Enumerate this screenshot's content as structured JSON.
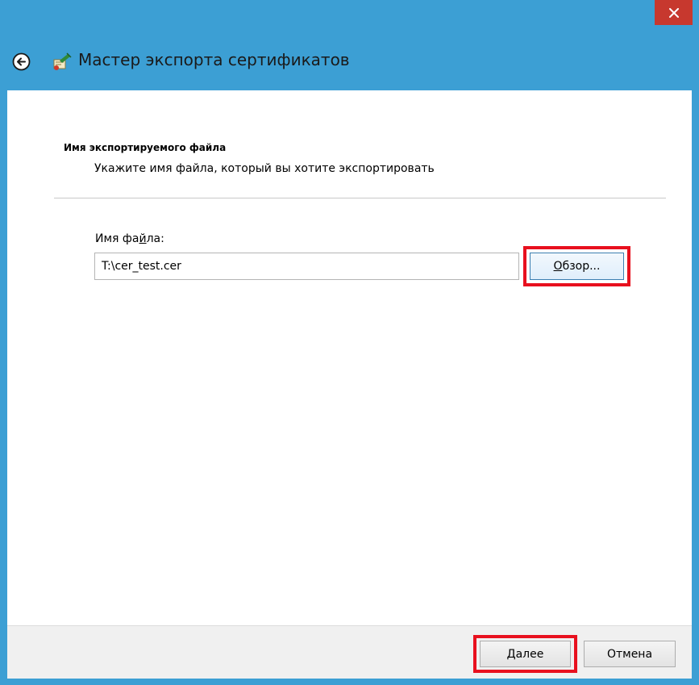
{
  "window": {
    "title": "Мастер экспорта сертификатов",
    "close_label": "✕"
  },
  "page": {
    "heading": "Имя экспортируемого файла",
    "description": "Укажите имя файла, который вы хотите экспортировать"
  },
  "file_field": {
    "label_before": "Имя фа",
    "label_hotkey": "й",
    "label_after": "ла:",
    "value": "T:\\cer_test.cer"
  },
  "browse_button": {
    "hotkey": "О",
    "rest": "бзор..."
  },
  "footer": {
    "next_hotkey": "Д",
    "next_rest": "алее",
    "cancel_label": "Отмена"
  },
  "icons": {
    "back": "back-arrow-icon",
    "wizard": "certificate-wizard-icon",
    "close": "close-icon"
  },
  "colors": {
    "titlebar": "#3c9fd4",
    "close": "#c7382e",
    "highlight": "#e8101e"
  }
}
